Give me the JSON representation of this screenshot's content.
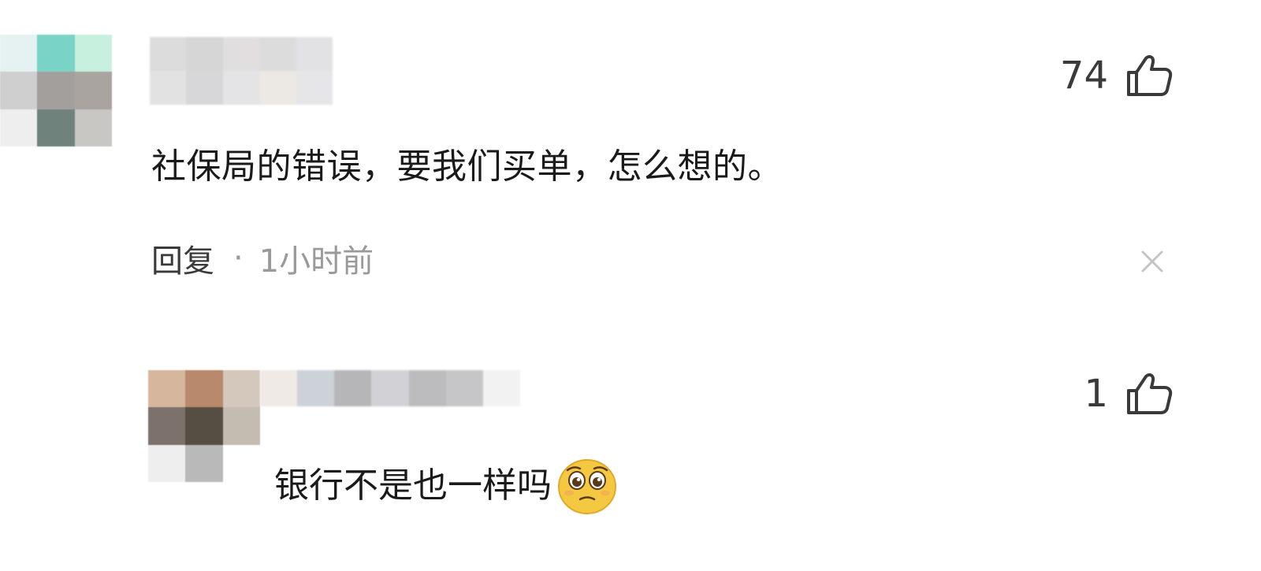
{
  "comment": {
    "text": "社保局的错误，要我们买单，怎么想的。",
    "likes": "74",
    "reply_label": "回复",
    "separator": "·",
    "time": "1小时前"
  },
  "reply": {
    "text": "银行不是也一样吗",
    "likes": "1",
    "emoji_icon": "pleading-face-emoji"
  },
  "icons": {
    "like": "thumbs-up-icon",
    "close": "close-icon"
  },
  "colors": {
    "text_primary": "#1a1a1a",
    "text_secondary": "#9a9a9a",
    "emoji": "#f5c842"
  }
}
